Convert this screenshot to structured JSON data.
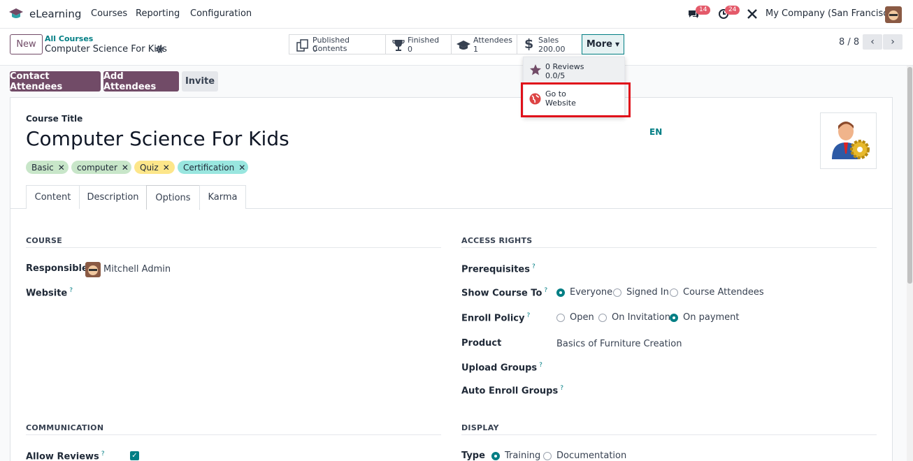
{
  "nav": {
    "app": "eLearning",
    "menu": [
      "Courses",
      "Reporting",
      "Configuration"
    ],
    "msg_count": "14",
    "activity_count": "24",
    "company": "My Company (San Francisco)"
  },
  "control": {
    "new_label": "New",
    "breadcrumb_parent": "All Courses",
    "record_name": "Computer Science For Kids",
    "stats": [
      {
        "label": "Published Contents",
        "value": "0"
      },
      {
        "label": "Finished",
        "value": "0"
      },
      {
        "label": "Attendees",
        "value": "1"
      },
      {
        "label": "Sales",
        "value": "200.00"
      }
    ],
    "more_label": "More",
    "pager": "8 / 8"
  },
  "dropdown": {
    "reviews_label": "0 Reviews",
    "reviews_value": "0.0/5",
    "website_line1": "Go to",
    "website_line2": "Website"
  },
  "actions": {
    "contact": "Contact Attendees",
    "add": "Add Attendees",
    "invite": "Invite"
  },
  "form": {
    "title_label": "Course Title",
    "title": "Computer Science For Kids",
    "lang": "EN",
    "tags": [
      {
        "label": "Basic",
        "color": "#c8e6c9"
      },
      {
        "label": "computer",
        "color": "#c8e6c9"
      },
      {
        "label": "Quiz",
        "color": "#fde68a"
      },
      {
        "label": "Certification",
        "color": "#99e6df"
      }
    ],
    "tabs": [
      "Content",
      "Description",
      "Options",
      "Karma"
    ],
    "active_tab": "Options"
  },
  "course": {
    "section": "COURSE",
    "responsible_label": "Responsible",
    "responsible_value": "Mitchell Admin",
    "website_label": "Website"
  },
  "access": {
    "section": "ACCESS RIGHTS",
    "prereq_label": "Prerequisites",
    "show_label": "Show Course To",
    "show_options": [
      "Everyone",
      "Signed In",
      "Course Attendees"
    ],
    "show_selected": "Everyone",
    "enroll_label": "Enroll Policy",
    "enroll_options": [
      "Open",
      "On Invitation",
      "On payment"
    ],
    "enroll_selected": "On payment",
    "product_label": "Product",
    "product_value": "Basics of Furniture Creation",
    "upload_label": "Upload Groups",
    "auto_label": "Auto Enroll Groups"
  },
  "communication": {
    "section": "COMMUNICATION",
    "reviews_label": "Allow Reviews",
    "reviews_checked": true
  },
  "display": {
    "section": "DISPLAY",
    "type_label": "Type",
    "type_options": [
      "Training",
      "Documentation"
    ],
    "type_selected": "Training"
  },
  "colors": {
    "brand": "#714b67",
    "accent": "#017e84",
    "highlight": "#e0101a"
  }
}
